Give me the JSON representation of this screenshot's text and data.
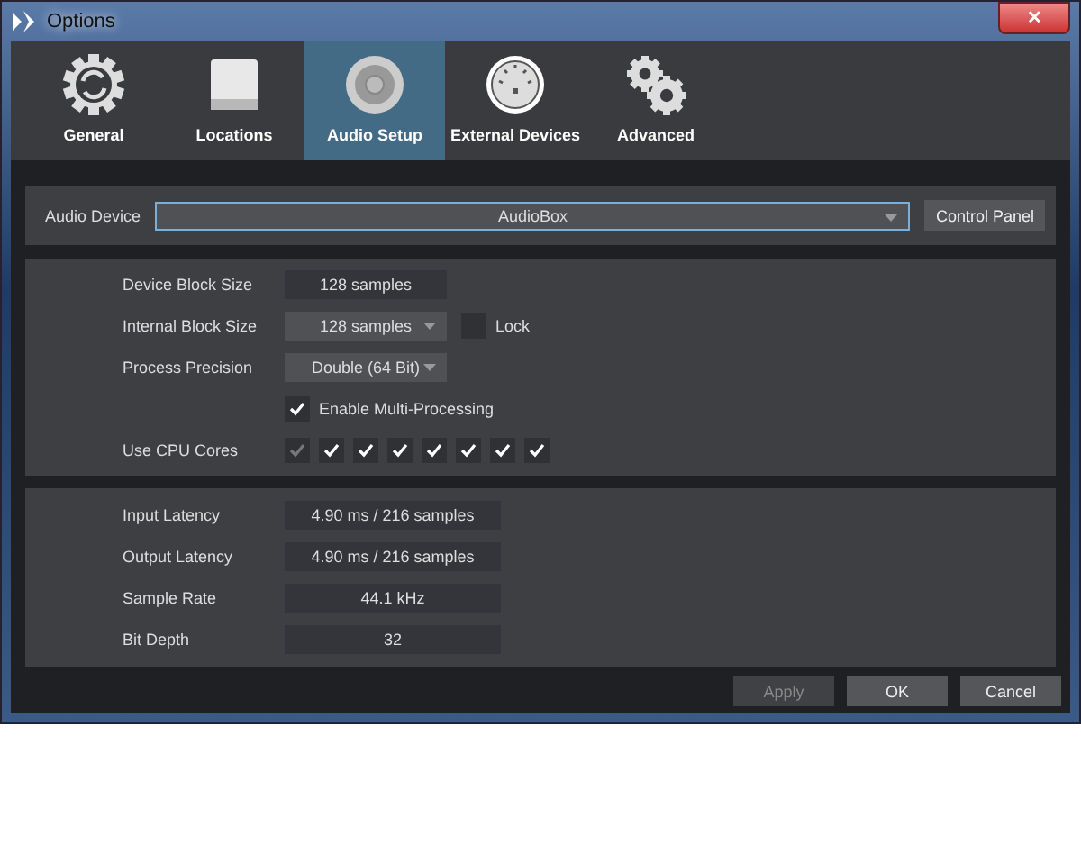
{
  "window": {
    "title": "Options",
    "close": "✕"
  },
  "tabs": [
    {
      "label": "General",
      "selected": false
    },
    {
      "label": "Locations",
      "selected": false
    },
    {
      "label": "Audio Setup",
      "selected": true
    },
    {
      "label": "External Devices",
      "selected": false
    },
    {
      "label": "Advanced",
      "selected": false
    }
  ],
  "audio_device": {
    "label": "Audio Device",
    "value": "AudioBox",
    "button": "Control Panel"
  },
  "settings": [
    {
      "kind": "value",
      "label": "Device Block Size",
      "value": "128 samples"
    },
    {
      "kind": "dropdown",
      "label": "Internal Block Size",
      "value": "128 samples",
      "lock": {
        "label": "Lock",
        "checked": false
      }
    },
    {
      "kind": "dropdown",
      "label": "Process Precision",
      "value": "Double (64 Bit)"
    },
    {
      "kind": "checkbox",
      "label": "Enable Multi-Processing",
      "checked": true
    },
    {
      "kind": "cores",
      "label": "Use CPU Cores",
      "cores": [
        {
          "checked": true,
          "disabled": true
        },
        {
          "checked": true,
          "disabled": false
        },
        {
          "checked": true,
          "disabled": false
        },
        {
          "checked": true,
          "disabled": false
        },
        {
          "checked": true,
          "disabled": false
        },
        {
          "checked": true,
          "disabled": false
        },
        {
          "checked": true,
          "disabled": false
        },
        {
          "checked": true,
          "disabled": false
        }
      ]
    }
  ],
  "info": [
    {
      "label": "Input Latency",
      "value": "4.90 ms / 216 samples"
    },
    {
      "label": "Output Latency",
      "value": "4.90 ms / 216 samples"
    },
    {
      "label": "Sample Rate",
      "value": "44.1 kHz"
    },
    {
      "label": "Bit Depth",
      "value": "32"
    }
  ],
  "buttons": [
    {
      "label": "Apply",
      "disabled": true
    },
    {
      "label": "OK",
      "disabled": false
    },
    {
      "label": "Cancel",
      "disabled": false
    }
  ]
}
